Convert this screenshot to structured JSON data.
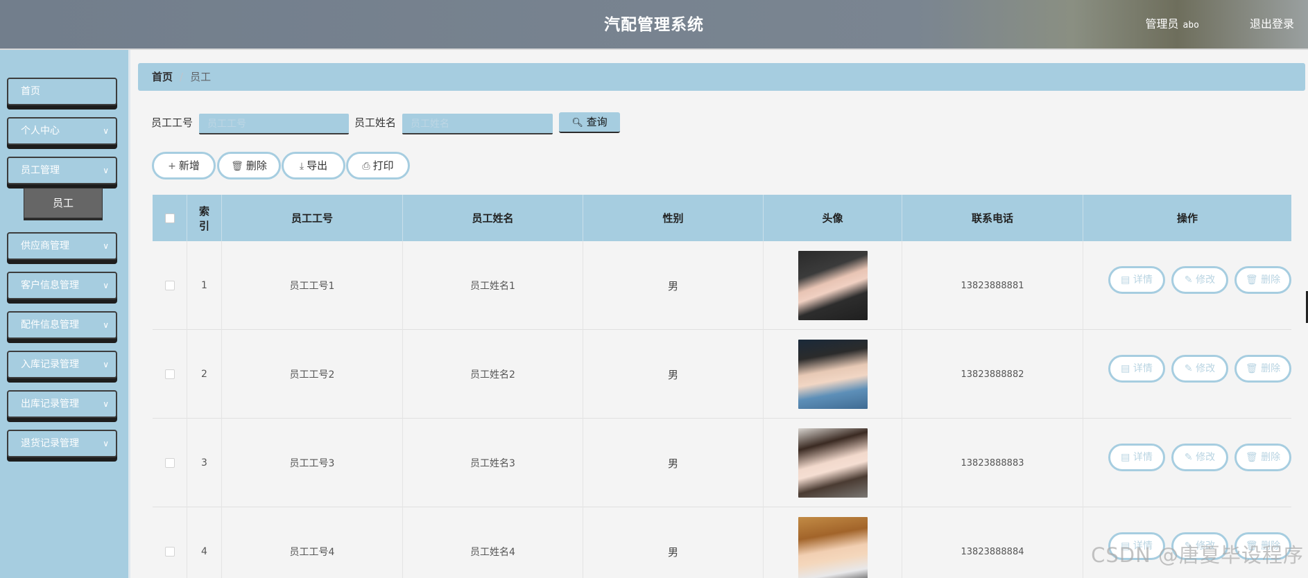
{
  "header": {
    "title": "汽配管理系统",
    "user_role": "管理员",
    "user_name": "abo",
    "logout": "退出登录"
  },
  "sidebar": {
    "items": [
      {
        "label": "首页",
        "has_chevron": false
      },
      {
        "label": "个人中心",
        "has_chevron": true
      },
      {
        "label": "员工管理",
        "has_chevron": true
      },
      {
        "label": "供应商管理",
        "has_chevron": true
      },
      {
        "label": "客户信息管理",
        "has_chevron": true
      },
      {
        "label": "配件信息管理",
        "has_chevron": true
      },
      {
        "label": "入库记录管理",
        "has_chevron": true
      },
      {
        "label": "出库记录管理",
        "has_chevron": true
      },
      {
        "label": "退货记录管理",
        "has_chevron": true
      }
    ],
    "sub_item": "员工",
    "chevron": "∨"
  },
  "breadcrumb": {
    "home": "首页",
    "separator": "/",
    "current": "员工"
  },
  "search": {
    "id_label": "员工工号",
    "id_placeholder": "员工工号",
    "id_value": "",
    "name_label": "员工姓名",
    "name_placeholder": "员工姓名",
    "query_icon": "search-icon",
    "query_glyph": "🔍︎",
    "query_label": "查询"
  },
  "actions": {
    "add": {
      "icon": "plus-icon",
      "glyph": "+",
      "label": "新增"
    },
    "delete": {
      "icon": "trash-icon",
      "glyph": "🗑︎",
      "label": "删除"
    },
    "export": {
      "icon": "download-icon",
      "glyph": "⤓",
      "label": "导出"
    },
    "print": {
      "icon": "printer-icon",
      "glyph": "⎙",
      "label": "打印"
    }
  },
  "table": {
    "headers": [
      "",
      "索引",
      "员工工号",
      "员工姓名",
      "性别",
      "头像",
      "联系电话",
      "操作"
    ],
    "rows": [
      {
        "index": "1",
        "id": "员工工号1",
        "name": "员工姓名1",
        "gender": "男",
        "phone": "13823888881",
        "avatar": "photo-woman-dark-hair"
      },
      {
        "index": "2",
        "id": "员工工号2",
        "name": "员工姓名2",
        "gender": "男",
        "phone": "13823888882",
        "avatar": "photo-man-denim-jacket"
      },
      {
        "index": "3",
        "id": "员工工号3",
        "name": "员工姓名3",
        "gender": "男",
        "phone": "13823888883",
        "avatar": "photo-woman-gray-top"
      },
      {
        "index": "4",
        "id": "员工工号4",
        "name": "员工姓名4",
        "gender": "男",
        "phone": "13823888884",
        "avatar": "photo-man-white-jacket"
      }
    ],
    "row_actions": [
      {
        "icon": "document-icon",
        "glyph": "▤",
        "label": "详情"
      },
      {
        "icon": "edit-icon",
        "glyph": "✎",
        "label": "修改"
      },
      {
        "icon": "trash-icon",
        "glyph": "🗑︎",
        "label": "删除"
      }
    ]
  },
  "watermark": "CSDN @唐夏毕设程序",
  "colors": {
    "accent": "#a6cde0",
    "header_bg": "#7a8591",
    "submenu_bg": "#666666"
  }
}
